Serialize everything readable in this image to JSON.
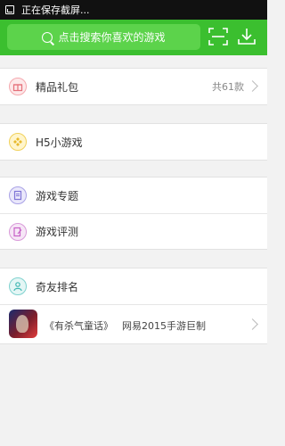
{
  "status_bar": {
    "text": "正在保存截屏..."
  },
  "header": {
    "search_placeholder": "点击搜索你喜欢的游戏"
  },
  "menu_groups": [
    {
      "items": [
        {
          "label": "精品礼包",
          "count": "共61款",
          "icon": "gift-icon"
        }
      ]
    },
    {
      "items": [
        {
          "label": "H5小游戏",
          "icon": "gamepad-icon"
        }
      ]
    },
    {
      "items": [
        {
          "label": "游戏专题",
          "icon": "document-icon"
        },
        {
          "label": "游戏评测",
          "icon": "edit-icon"
        }
      ]
    },
    {
      "items": [
        {
          "label": "奇友排名",
          "icon": "user-icon"
        }
      ]
    }
  ],
  "featured_game": {
    "title": "《有杀气童话》",
    "subtitle": "网易2015手游巨制"
  },
  "colors": {
    "header_green": "#3bbf2f",
    "search_green": "#5cd34b"
  }
}
